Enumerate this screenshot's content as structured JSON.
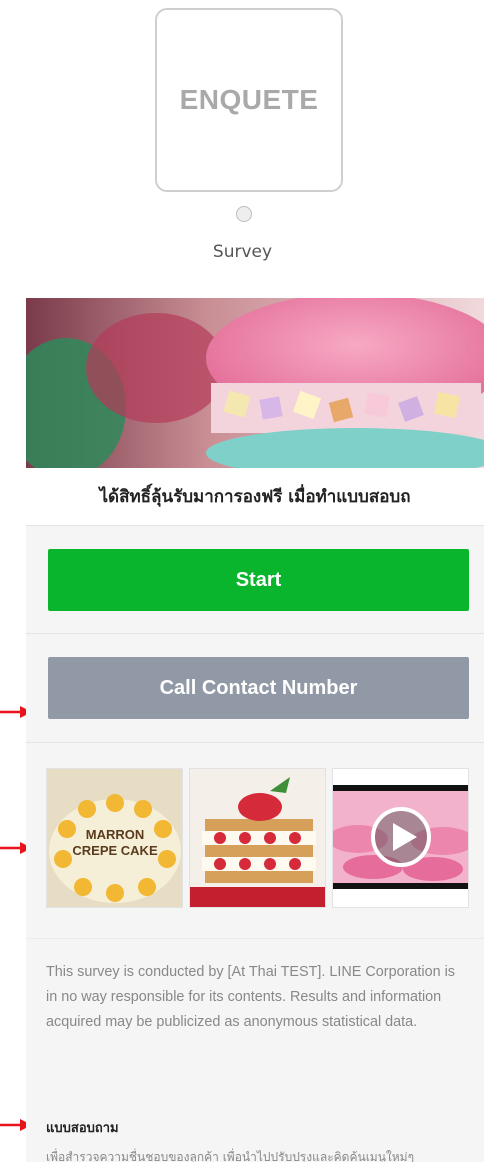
{
  "header": {
    "tile_text": "ENQUETE",
    "caption": "Survey"
  },
  "card": {
    "headline": "ได้สิทธิ์ลุ้นรับมาการองฟรี เมื่อทำแบบสอบถ",
    "start_label": "Start",
    "call_label": "Call Contact Number",
    "thumbnails": [
      {
        "caption": "MARRON CREPE CAKE",
        "caption_line1": "MARRON",
        "caption_line2": "CREPE CAKE",
        "kind": "image"
      },
      {
        "caption": "",
        "kind": "image"
      },
      {
        "caption": "",
        "kind": "video",
        "icon": "play-icon"
      }
    ],
    "disclaimer": "This survey is conducted by [At Thai TEST]. LINE Corporation is in no way responsible for its contents. Results and information acquired may be publicized as anonymous statistical data.",
    "section_title": "แบบสอบถาม",
    "section_desc": "เพื่อสำรวจความชื่นชอบของลูกค้า เพื่อนำไปปรับปรุงและคิดค้นเมนูใหม่ๆ"
  },
  "colors": {
    "start_button": "#09b52c",
    "call_button": "#9198a6",
    "annotation_arrow": "#e8141c"
  }
}
